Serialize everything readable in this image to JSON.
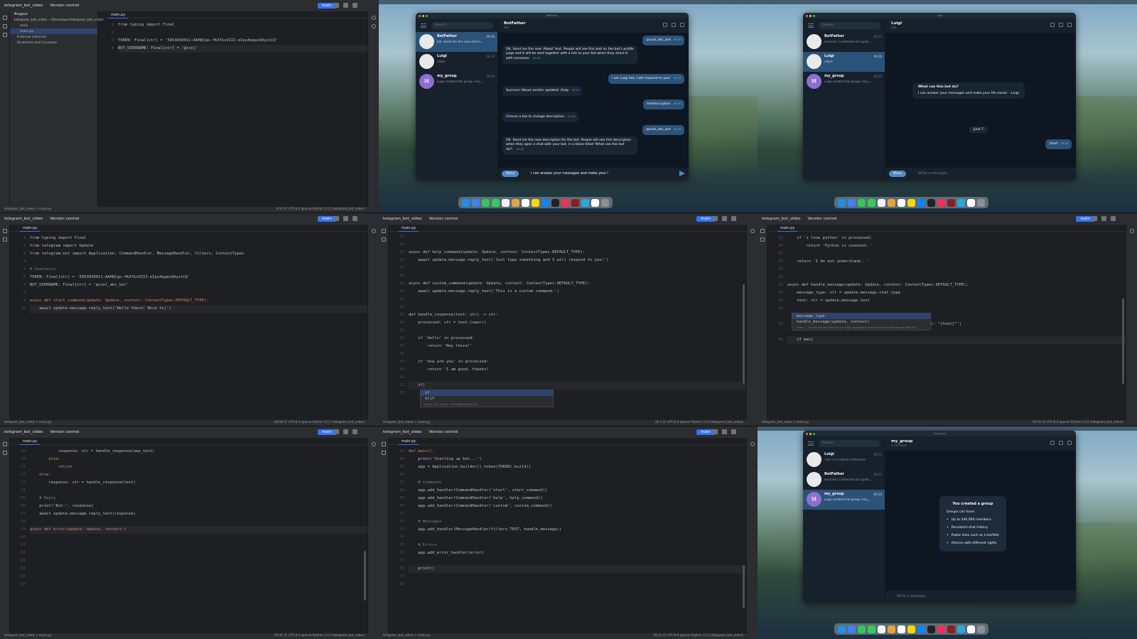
{
  "ide": {
    "project_name": "telegram_bot_video",
    "vcs": "Version control",
    "branch": "main",
    "tab": "main.py",
    "python": "Python 3.11 (telegram_bot_video)",
    "status_path": "telegram_bot_video  >  main.py"
  },
  "panel0": {
    "project_label": "Project",
    "tree": [
      "telegram_bot_video  ~/Developer/telegram_bot_video",
      "venv",
      "main.py",
      "External Libraries",
      "Scratches and Consoles"
    ],
    "code": [
      {
        "n": "1",
        "t": "from typing import Final"
      },
      {
        "n": "2",
        "t": ""
      },
      {
        "n": "3",
        "t": "TOKEN: Final[str] = '5853030011:AAHQCgo-fKd7ksVZZJ-eIpsAqqasQAyziCQ'"
      },
      {
        "n": "4",
        "t": "BOT_USERNAME: Final[str] = '@coo|'"
      }
    ],
    "status_right": "4:33   LF   UTF-8   4 spaces   Python 3.11 (telegram_bot_video)"
  },
  "panel1": {
    "window_title": "BotFather",
    "search": "Search",
    "chats": [
      {
        "name": "BotFather",
        "time": "09:26",
        "msg": "OK. Send me the new descri..."
      },
      {
        "name": "Luigi",
        "time": "09:26",
        "msg": "/start"
      },
      {
        "name": "my_group",
        "time": "09:20",
        "msg": "Luigi created the group «my_..."
      }
    ],
    "header_title": "BotFather",
    "header_sub": "bot",
    "messages": [
      {
        "text": "@cool_abc_bot",
        "time": "09:28"
      },
      {
        "text": "OK. Send me the new 'About' text. People will see this text on the bot's profile page and it will be sent together with a link to your bot when they share it with someone.",
        "time": "09:28"
      },
      {
        "text": "I am Luigi bot, I will respond to you!",
        "time": "09:28"
      },
      {
        "text": "Success! About section updated. /help",
        "time": "09:28"
      },
      {
        "text": "/setdescription",
        "time": "09:28"
      },
      {
        "text": "Choose a bot to change description.",
        "time": "09:28"
      },
      {
        "text": "@cool_abc_bot",
        "time": "09:28"
      },
      {
        "text": "OK. Send me the new description for the bot. People will see this description when they open a chat with your bot, in a block titled 'What can this bot do?'.",
        "time": "09:28"
      }
    ],
    "menu_label": "Menu",
    "input_value": "I can answer your messages and make your l"
  },
  "panel2": {
    "window_title": "Luigi",
    "search": "Search",
    "chats": [
      {
        "name": "BotFather",
        "time": "09:31",
        "msg": "Success! Command list upda..."
      },
      {
        "name": "Luigi",
        "time": "09:26",
        "msg": "/start"
      },
      {
        "name": "my_group",
        "time": "09:20",
        "msg": "Luigi created the group «my_..."
      }
    ],
    "header_title": "Luigi",
    "header_sub": "bot",
    "info_title": "What can this bot do?",
    "info_text": "I can answer your messages and make your life easier. - Luigi",
    "date": "June 7",
    "out_msg": "/start",
    "out_time": "09:26",
    "menu_label": "Menu",
    "placeholder": "Write a message..."
  },
  "panel3": {
    "code": [
      {
        "n": "1",
        "t": "from typing import Final"
      },
      {
        "n": "2",
        "t": "from telegram import Update"
      },
      {
        "n": "3",
        "t": "from telegram.ext import Application, CommandHandler, MessageHandler, filters, ContextTypes"
      },
      {
        "n": "4",
        "t": ""
      },
      {
        "n": "5",
        "t": "# Constants"
      },
      {
        "n": "6",
        "t": "TOKEN: Final[str] = '5853030011:AAHQCgo-fKd7ksVZZJ-eIpsAqqasQAyziCQ'"
      },
      {
        "n": "7",
        "t": "BOT_USERNAME: Final[str] = '@cool_abc_bot'"
      },
      {
        "n": "8",
        "t": ""
      },
      {
        "n": "9",
        "t": "async def start_command(update: Update, context: ContextTypes.DEFAULT_TYPE):"
      },
      {
        "n": "10",
        "t": "    await update.message.reply_text('Hello there! Nice to|')"
      }
    ],
    "crumb": "async start_command()",
    "status_right": "10:58   LF   UTF-8   4 spaces   Python 3.11 (telegram_bot_video)"
  },
  "panel4": {
    "code": [
      {
        "n": "13",
        "t": ""
      },
      {
        "n": "14",
        "t": ""
      },
      {
        "n": "15",
        "t": "async def help_command(update: Update, context: ContextTypes.DEFAULT_TYPE):"
      },
      {
        "n": "16",
        "t": "    await update.message.reply_text('Just type something and I will respond to you!')"
      },
      {
        "n": "17",
        "t": ""
      },
      {
        "n": "18",
        "t": ""
      },
      {
        "n": "19",
        "t": "async def custom_command(update: Update, context: ContextTypes.DEFAULT_TYPE):"
      },
      {
        "n": "20",
        "t": "    await update.message.reply_text('This is a custom command.')"
      },
      {
        "n": "21",
        "t": ""
      },
      {
        "n": "22",
        "t": ""
      },
      {
        "n": "23",
        "t": "def handle_response(text: str) -> str:"
      },
      {
        "n": "24",
        "t": "    processed: str = text.lower()"
      },
      {
        "n": "25",
        "t": ""
      },
      {
        "n": "26",
        "t": "    if 'hello' in processed:"
      },
      {
        "n": "27",
        "t": "        return 'Hey there!'"
      },
      {
        "n": "28",
        "t": ""
      },
      {
        "n": "29",
        "t": "    if 'how are you' in processed:"
      },
      {
        "n": "30",
        "t": "        return 'I am good, thanks!'"
      },
      {
        "n": "31",
        "t": ""
      },
      {
        "n": "32",
        "t": "    if|"
      },
      {
        "n": "33",
        "t": ""
      }
    ],
    "popup": [
      "if",
      "elif"
    ],
    "popup_hint": "Press ⏎ to insert, → to replace  Next Tip",
    "status_right": "31:7   LF   UTF-8   4 spaces   Python 3.11 (telegram_bot_video)"
  },
  "panel5": {
    "code": [
      {
        "n": "33",
        "t": "    if 'i love python' in processed:"
      },
      {
        "n": "34",
        "t": "        return 'Python is cooooool.'"
      },
      {
        "n": "35",
        "t": ""
      },
      {
        "n": "36",
        "t": "    return 'I do not understand...'"
      },
      {
        "n": "37",
        "t": ""
      },
      {
        "n": "38",
        "t": ""
      },
      {
        "n": "39",
        "t": "async def handle_message(update: Update, context: ContextTypes.DEFAULT_TYPE):"
      },
      {
        "n": "40",
        "t": "    message_type: str = update.message.chat.type"
      },
      {
        "n": "41",
        "t": "    text: str = update.message.text"
      },
      {
        "n": "42",
        "t": ""
      },
      {
        "n": "43",
        "t": "                                                          ype): \"{text}\"')"
      },
      {
        "n": "44",
        "t": "    if mes|"
      }
    ],
    "popup": [
      "message_type",
      "handle_message(update, context)"
    ],
    "popup_hint": "Press ^. to choose the selected (or first) suggestion and insert a dot afterwards  Next Tip",
    "crumb": "async handle_message()   if mes",
    "status_right": "44:11   LF   UTF-8   4 spaces   Python 3.11 (telegram_bot_video)"
  },
  "panel6": {
    "code": [
      {
        "n": "49",
        "t": "            response: str = handle_response(new_text)"
      },
      {
        "n": "50",
        "t": "        else:"
      },
      {
        "n": "51",
        "t": "            return"
      },
      {
        "n": "52",
        "t": "    else:"
      },
      {
        "n": "53",
        "t": "        response: str = handle_response(text)"
      },
      {
        "n": "54",
        "t": ""
      },
      {
        "n": "55",
        "t": "    # Reply"
      },
      {
        "n": "56",
        "t": "    print('Bot:', response)"
      },
      {
        "n": "57",
        "t": "    await update.message.reply_text(response)"
      },
      {
        "n": "58",
        "t": ""
      },
      {
        "n": "59",
        "t": "async def error(update: Update, context:)"
      },
      {
        "n": "60",
        "t": ""
      },
      {
        "n": "61",
        "t": ""
      },
      {
        "n": "62",
        "t": ""
      },
      {
        "n": "63",
        "t": ""
      },
      {
        "n": "64",
        "t": ""
      },
      {
        "n": "65",
        "t": ""
      },
      {
        "n": "66",
        "t": ""
      }
    ],
    "crumb": "async error()",
    "status_right": "59:41   LF   UTF-8   4 spaces   Python 3.11 (telegram_bot_video)"
  },
  "panel7": {
    "code": [
      {
        "n": "63",
        "t": "def main():"
      },
      {
        "n": "64",
        "t": "    print('Starting up bot...')"
      },
      {
        "n": "65",
        "t": "    app = Application.builder().token(TOKEN).build()"
      },
      {
        "n": "66",
        "t": ""
      },
      {
        "n": "67",
        "t": "    # Commands"
      },
      {
        "n": "68",
        "t": "    app.add_handler(CommandHandler('start', start_command))"
      },
      {
        "n": "69",
        "t": "    app.add_handler(CommandHandler('help', help_command))"
      },
      {
        "n": "70",
        "t": "    app.add_handler(CommandHandler('custom', custom_command))"
      },
      {
        "n": "71",
        "t": ""
      },
      {
        "n": "72",
        "t": "    # Messages"
      },
      {
        "n": "73",
        "t": "    app.add_handler(MessageHandler(filters.TEXT, handle_message))"
      },
      {
        "n": "74",
        "t": ""
      },
      {
        "n": "75",
        "t": "    # Errors"
      },
      {
        "n": "76",
        "t": "    app.add_error_handler(error)"
      },
      {
        "n": "77",
        "t": ""
      },
      {
        "n": "78",
        "t": "    print()"
      },
      {
        "n": "79",
        "t": ""
      },
      {
        "n": "80",
        "t": ""
      }
    ],
    "crumb": "main()",
    "status_right": "78:11   LF   UTF-8   4 spaces   Python 3.11 (telegram_bot_video)"
  },
  "panel8": {
    "window_title": "my_group",
    "search": "Search",
    "chats": [
      {
        "name": "Luigi",
        "time": "09:52",
        "msg": "This is a custom command."
      },
      {
        "name": "BotFather",
        "time": "09:31",
        "msg": "Success! Command list upda..."
      },
      {
        "name": "my_group",
        "time": "09:20",
        "msg": "Luigi created the group «my_..."
      }
    ],
    "header_title": "my_group",
    "header_sub": "1 member",
    "info_title": "You created a group",
    "info_sub": "Groups can have:",
    "info_items": [
      "Up to 200,000 members",
      "Persistent chat history",
      "Public links such as t.me/title",
      "Admins with different rights"
    ],
    "placeholder": "Write a message..."
  }
}
